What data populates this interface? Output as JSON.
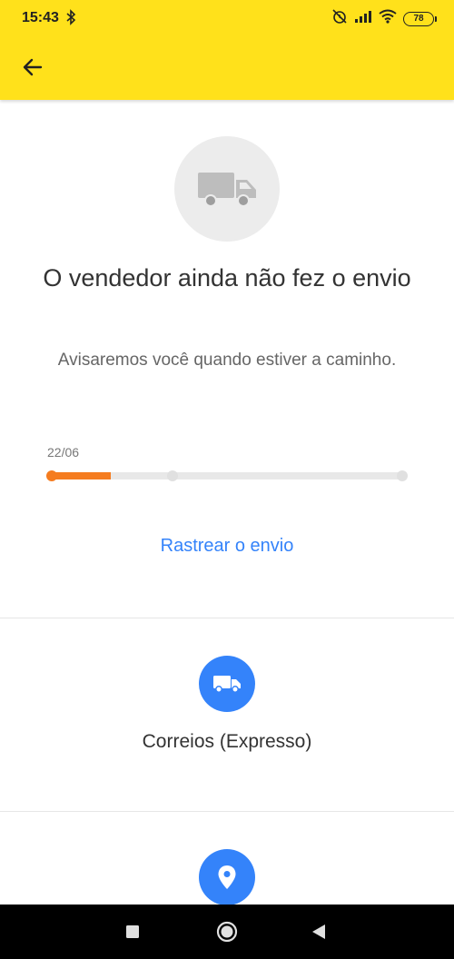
{
  "status_bar": {
    "time": "15:43",
    "battery": "78",
    "icons": [
      "bluetooth-icon",
      "alarm-off-icon",
      "signal-icon",
      "wifi-icon",
      "battery-icon"
    ]
  },
  "header": {
    "back_icon": "arrow-left-icon",
    "color": "#ffe11b"
  },
  "shipment": {
    "icon": "truck-icon",
    "title": "O vendedor ainda não fez o envio",
    "subtitle": "Avisaremos você quando estiver a caminho.",
    "date": "22/06",
    "progress": 0.17,
    "progress_color": "#f57c1f",
    "track_link": "Rastrear o envio"
  },
  "carrier": {
    "icon": "truck-icon",
    "name": "Correios (Expresso)"
  },
  "destination": {
    "icon": "location-pin-icon"
  },
  "navigation_bar": {
    "buttons": [
      "recents-square-icon",
      "home-circle-icon",
      "back-triangle-icon"
    ]
  },
  "colors": {
    "accent": "#3483fa",
    "background": "#ffffff"
  }
}
